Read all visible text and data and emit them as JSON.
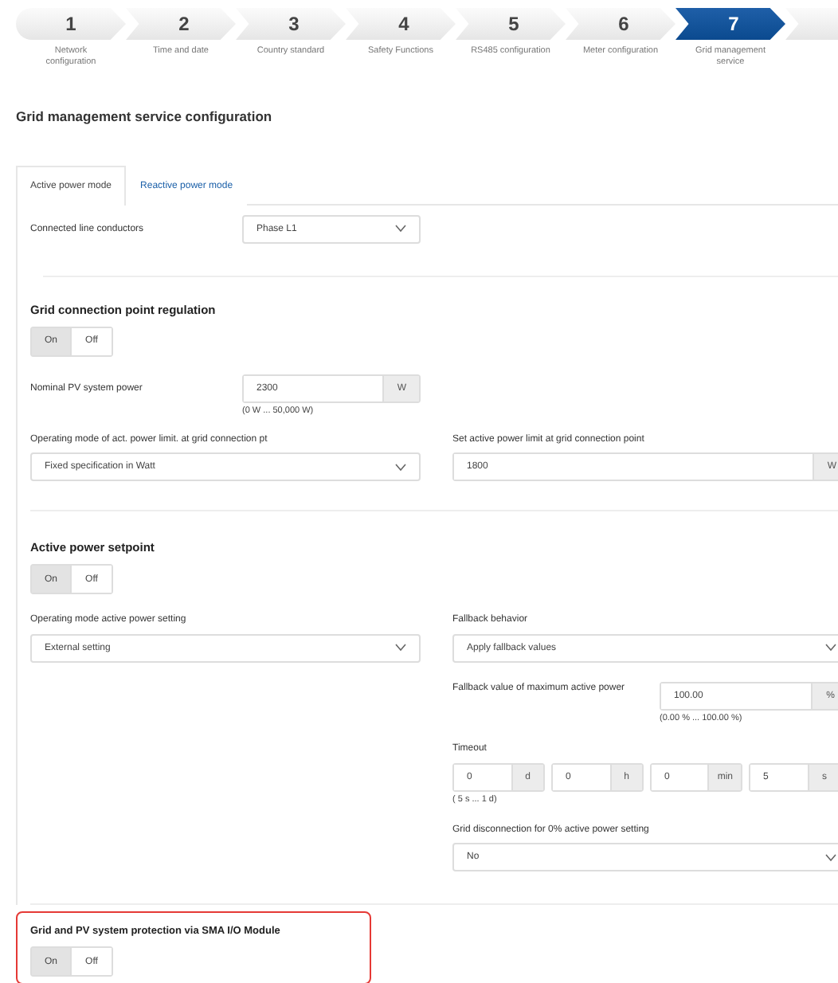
{
  "steps": [
    {
      "number": "1",
      "label": "Network configuration",
      "selected": false
    },
    {
      "number": "2",
      "label": "Time and date",
      "selected": false
    },
    {
      "number": "3",
      "label": "Country standard",
      "selected": false
    },
    {
      "number": "4",
      "label": "Safety Functions",
      "selected": false
    },
    {
      "number": "5",
      "label": "RS485 configuration",
      "selected": false
    },
    {
      "number": "6",
      "label": "Meter configuration",
      "selected": false
    },
    {
      "number": "7",
      "label": "Grid management service",
      "selected": true
    },
    {
      "selected": false
    }
  ],
  "title": "Grid management service configuration",
  "tabs": [
    {
      "label": "Active power mode",
      "selected": true
    },
    {
      "label": "Reactive power mode",
      "selected": false
    }
  ],
  "connected_line_conductors": {
    "label": "Connected line conductors",
    "value": "Phase L1"
  },
  "grid_connection_point_regulation": {
    "heading": "Grid connection point regulation",
    "toggle": [
      {
        "label": "On",
        "selected": true
      },
      {
        "label": "Off",
        "selected": false
      }
    ],
    "nominal_power": {
      "label": "Nominal PV system power",
      "value": "2300",
      "unit": "W",
      "hint": "(0 W ... 50,000 W)"
    },
    "operating_mode": {
      "label": "Operating mode of act. power limit. at grid connection pt",
      "value": "Fixed specification in Watt"
    },
    "power_limit": {
      "label": "Set active power limit at grid connection point",
      "value": "1800",
      "unit": "W"
    }
  },
  "active_power_setpoint": {
    "heading": "Active power setpoint",
    "toggle": [
      {
        "label": "On",
        "selected": true
      },
      {
        "label": "Off",
        "selected": false
      }
    ],
    "operating_mode": {
      "label": "Operating mode active power setting",
      "value": "External setting"
    },
    "fallback_behavior": {
      "label": "Fallback behavior",
      "value": "Apply fallback values"
    },
    "fallback_value": {
      "label": "Fallback value of maximum active power",
      "value": "100.00",
      "unit": "%",
      "hint": "(0.00 % ... 100.00 %)"
    },
    "timeout": {
      "label": "Timeout",
      "parts": [
        {
          "value": "0",
          "unit": "d"
        },
        {
          "value": "0",
          "unit": "h"
        },
        {
          "value": "0",
          "unit": "min"
        },
        {
          "value": "5",
          "unit": "s"
        }
      ],
      "hint": "( 5 s ... 1 d)"
    },
    "grid_disconnection": {
      "label": "Grid disconnection for 0% active power setting",
      "value": "No"
    }
  },
  "io_module_protection": {
    "heading": "Grid and PV system protection via SMA I/O Module",
    "highlighted": true,
    "toggle": [
      {
        "label": "On",
        "selected": true
      },
      {
        "label": "Off",
        "selected": false
      }
    ]
  }
}
